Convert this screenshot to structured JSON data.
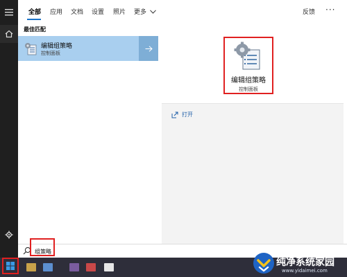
{
  "tabs": [
    {
      "label": "全部",
      "active": true
    },
    {
      "label": "应用",
      "active": false
    },
    {
      "label": "文档",
      "active": false
    },
    {
      "label": "设置",
      "active": false
    },
    {
      "label": "照片",
      "active": false
    },
    {
      "label": "更多",
      "active": false
    }
  ],
  "header": {
    "feedback_label": "反馈",
    "more_menu_glyph": "···"
  },
  "results": {
    "section_title": "最佳匹配",
    "best_match": {
      "name": "编辑组策略",
      "subtitle": "控制面板"
    }
  },
  "detail": {
    "name": "编辑组策略",
    "subtitle": "控制面板",
    "actions": [
      {
        "label": "打开",
        "icon": "open-icon"
      }
    ]
  },
  "search": {
    "query": "组策略"
  },
  "watermark": {
    "name": "纯净系统家园",
    "url": "www.yidaimei.com"
  },
  "colors": {
    "accent": "#1a73c8",
    "selected_row": "#a9cfef",
    "highlight_box": "#e02020",
    "rail": "#1f1f1f",
    "taskbar": "#2e2e3a"
  }
}
